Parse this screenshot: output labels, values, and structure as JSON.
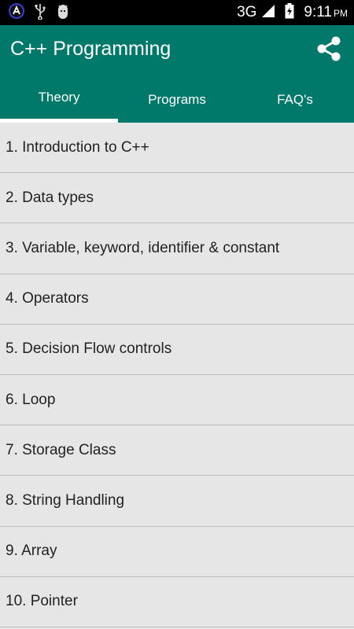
{
  "status_bar": {
    "network": "3G",
    "time": "9:11",
    "ampm": "PM",
    "icons": [
      "app-icon",
      "usb-icon",
      "android-debug-icon",
      "signal-icon",
      "battery-charging-icon"
    ]
  },
  "app_bar": {
    "title": "C++ Programming",
    "share_icon": "share-icon"
  },
  "tabs": [
    {
      "label": "Theory",
      "selected": true
    },
    {
      "label": "Programs",
      "selected": false
    },
    {
      "label": "FAQ's",
      "selected": false
    }
  ],
  "topics": [
    "1. Introduction to C++",
    "2. Data types",
    "3. Variable, keyword, identifier & constant",
    "4. Operators",
    "5. Decision Flow controls",
    "6. Loop",
    "7. Storage Class",
    "8. String Handling",
    "9. Array",
    "10. Pointer"
  ],
  "colors": {
    "primary": "#00796b",
    "list_background": "#e6e6e6",
    "divider": "#bdbdbd"
  }
}
